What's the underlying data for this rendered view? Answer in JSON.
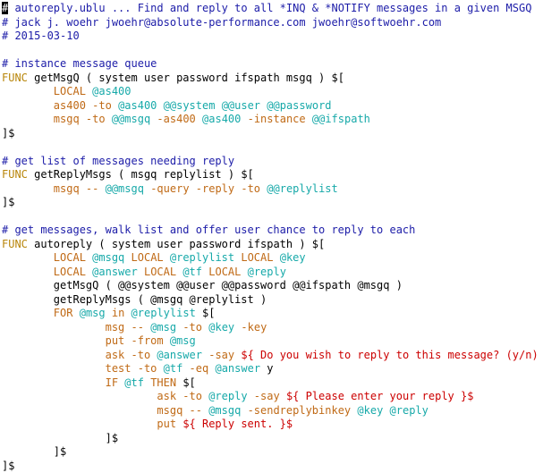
{
  "colors": {
    "comment": "#1c1ca8",
    "keyword": "#b8860b",
    "builtin": "#c06a16",
    "variable": "#17a9a9",
    "string": "#cc0000",
    "text": "#000000",
    "background": "#ffffff"
  },
  "cursor_char": "#",
  "lines": [
    [
      [
        "cursor",
        "#"
      ],
      [
        "c-comment",
        " autoreply.ublu ... Find and reply to all *INQ & *NOTIFY messages in a given MSGQ"
      ]
    ],
    [
      [
        "c-comment",
        "# jack j. woehr jwoehr@absolute-performance.com jwoehr@softwoehr.com"
      ]
    ],
    [
      [
        "c-comment",
        "# 2015-03-10"
      ]
    ],
    [
      [
        "c-plain",
        ""
      ]
    ],
    [
      [
        "c-comment",
        "# instance message queue"
      ]
    ],
    [
      [
        "c-keyword",
        "FUNC"
      ],
      [
        "c-plain",
        " getMsgQ ( system user password ifspath msgq ) $["
      ]
    ],
    [
      [
        "c-plain",
        "        "
      ],
      [
        "c-orange",
        "LOCAL"
      ],
      [
        "c-plain",
        " "
      ],
      [
        "c-var",
        "@as400"
      ]
    ],
    [
      [
        "c-plain",
        "        "
      ],
      [
        "c-orange",
        "as400 -to"
      ],
      [
        "c-plain",
        " "
      ],
      [
        "c-var",
        "@as400"
      ],
      [
        "c-plain",
        " "
      ],
      [
        "c-var",
        "@@system"
      ],
      [
        "c-plain",
        " "
      ],
      [
        "c-var",
        "@@user"
      ],
      [
        "c-plain",
        " "
      ],
      [
        "c-var",
        "@@password"
      ]
    ],
    [
      [
        "c-plain",
        "        "
      ],
      [
        "c-orange",
        "msgq -to"
      ],
      [
        "c-plain",
        " "
      ],
      [
        "c-var",
        "@@msgq"
      ],
      [
        "c-plain",
        " "
      ],
      [
        "c-orange",
        "-as400"
      ],
      [
        "c-plain",
        " "
      ],
      [
        "c-var",
        "@as400"
      ],
      [
        "c-plain",
        " "
      ],
      [
        "c-orange",
        "-instance"
      ],
      [
        "c-plain",
        " "
      ],
      [
        "c-var",
        "@@ifspath"
      ]
    ],
    [
      [
        "c-plain",
        "]$"
      ]
    ],
    [
      [
        "c-plain",
        ""
      ]
    ],
    [
      [
        "c-comment",
        "# get list of messages needing reply"
      ]
    ],
    [
      [
        "c-keyword",
        "FUNC"
      ],
      [
        "c-plain",
        " getReplyMsgs ( msgq replylist ) $["
      ]
    ],
    [
      [
        "c-plain",
        "        "
      ],
      [
        "c-orange",
        "msgq --"
      ],
      [
        "c-plain",
        " "
      ],
      [
        "c-var",
        "@@msgq"
      ],
      [
        "c-plain",
        " "
      ],
      [
        "c-orange",
        "-query -reply -to"
      ],
      [
        "c-plain",
        " "
      ],
      [
        "c-var",
        "@@replylist"
      ]
    ],
    [
      [
        "c-plain",
        "]$"
      ]
    ],
    [
      [
        "c-plain",
        ""
      ]
    ],
    [
      [
        "c-comment",
        "# get messages, walk list and offer user chance to reply to each"
      ]
    ],
    [
      [
        "c-keyword",
        "FUNC"
      ],
      [
        "c-plain",
        " autoreply ( system user password ifspath ) $["
      ]
    ],
    [
      [
        "c-plain",
        "        "
      ],
      [
        "c-orange",
        "LOCAL"
      ],
      [
        "c-plain",
        " "
      ],
      [
        "c-var",
        "@msgq"
      ],
      [
        "c-plain",
        " "
      ],
      [
        "c-orange",
        "LOCAL"
      ],
      [
        "c-plain",
        " "
      ],
      [
        "c-var",
        "@replylist"
      ],
      [
        "c-plain",
        " "
      ],
      [
        "c-orange",
        "LOCAL"
      ],
      [
        "c-plain",
        " "
      ],
      [
        "c-var",
        "@key"
      ]
    ],
    [
      [
        "c-plain",
        "        "
      ],
      [
        "c-orange",
        "LOCAL"
      ],
      [
        "c-plain",
        " "
      ],
      [
        "c-var",
        "@answer"
      ],
      [
        "c-plain",
        " "
      ],
      [
        "c-orange",
        "LOCAL"
      ],
      [
        "c-plain",
        " "
      ],
      [
        "c-var",
        "@tf"
      ],
      [
        "c-plain",
        " "
      ],
      [
        "c-orange",
        "LOCAL"
      ],
      [
        "c-plain",
        " "
      ],
      [
        "c-var",
        "@reply"
      ]
    ],
    [
      [
        "c-plain",
        "        getMsgQ ( @@system @@user @@password @@ifspath @msgq )"
      ]
    ],
    [
      [
        "c-plain",
        "        getReplyMsgs ( @msgq @replylist )"
      ]
    ],
    [
      [
        "c-plain",
        "        "
      ],
      [
        "c-orange",
        "FOR"
      ],
      [
        "c-plain",
        " "
      ],
      [
        "c-var",
        "@msg"
      ],
      [
        "c-plain",
        " "
      ],
      [
        "c-orange",
        "in"
      ],
      [
        "c-plain",
        " "
      ],
      [
        "c-var",
        "@replylist"
      ],
      [
        "c-plain",
        " $["
      ]
    ],
    [
      [
        "c-plain",
        "                "
      ],
      [
        "c-orange",
        "msg --"
      ],
      [
        "c-plain",
        " "
      ],
      [
        "c-var",
        "@msg"
      ],
      [
        "c-plain",
        " "
      ],
      [
        "c-orange",
        "-to"
      ],
      [
        "c-plain",
        " "
      ],
      [
        "c-var",
        "@key"
      ],
      [
        "c-plain",
        " "
      ],
      [
        "c-orange",
        "-key"
      ]
    ],
    [
      [
        "c-plain",
        "                "
      ],
      [
        "c-orange",
        "put -from"
      ],
      [
        "c-plain",
        " "
      ],
      [
        "c-var",
        "@msg"
      ]
    ],
    [
      [
        "c-plain",
        "                "
      ],
      [
        "c-orange",
        "ask -to"
      ],
      [
        "c-plain",
        " "
      ],
      [
        "c-var",
        "@answer"
      ],
      [
        "c-plain",
        " "
      ],
      [
        "c-orange",
        "-say"
      ],
      [
        "c-plain",
        " "
      ],
      [
        "c-string",
        "${ Do you wish to reply to this message? (y/n) }$"
      ]
    ],
    [
      [
        "c-plain",
        "                "
      ],
      [
        "c-orange",
        "test -to"
      ],
      [
        "c-plain",
        " "
      ],
      [
        "c-var",
        "@tf"
      ],
      [
        "c-plain",
        " "
      ],
      [
        "c-orange",
        "-eq"
      ],
      [
        "c-plain",
        " "
      ],
      [
        "c-var",
        "@answer"
      ],
      [
        "c-plain",
        " y"
      ]
    ],
    [
      [
        "c-plain",
        "                "
      ],
      [
        "c-orange",
        "IF"
      ],
      [
        "c-plain",
        " "
      ],
      [
        "c-var",
        "@tf"
      ],
      [
        "c-plain",
        " "
      ],
      [
        "c-orange",
        "THEN"
      ],
      [
        "c-plain",
        " $["
      ]
    ],
    [
      [
        "c-plain",
        "                        "
      ],
      [
        "c-orange",
        "ask -to"
      ],
      [
        "c-plain",
        " "
      ],
      [
        "c-var",
        "@reply"
      ],
      [
        "c-plain",
        " "
      ],
      [
        "c-orange",
        "-say"
      ],
      [
        "c-plain",
        " "
      ],
      [
        "c-string",
        "${ Please enter your reply }$"
      ]
    ],
    [
      [
        "c-plain",
        "                        "
      ],
      [
        "c-orange",
        "msgq --"
      ],
      [
        "c-plain",
        " "
      ],
      [
        "c-var",
        "@msgq"
      ],
      [
        "c-plain",
        " "
      ],
      [
        "c-orange",
        "-sendreplybinkey"
      ],
      [
        "c-plain",
        " "
      ],
      [
        "c-var",
        "@key"
      ],
      [
        "c-plain",
        " "
      ],
      [
        "c-var",
        "@reply"
      ]
    ],
    [
      [
        "c-plain",
        "                        "
      ],
      [
        "c-orange",
        "put"
      ],
      [
        "c-plain",
        " "
      ],
      [
        "c-string",
        "${ Reply sent. }$"
      ]
    ],
    [
      [
        "c-plain",
        "                ]$"
      ]
    ],
    [
      [
        "c-plain",
        "        ]$"
      ]
    ],
    [
      [
        "c-plain",
        "]$"
      ]
    ]
  ]
}
